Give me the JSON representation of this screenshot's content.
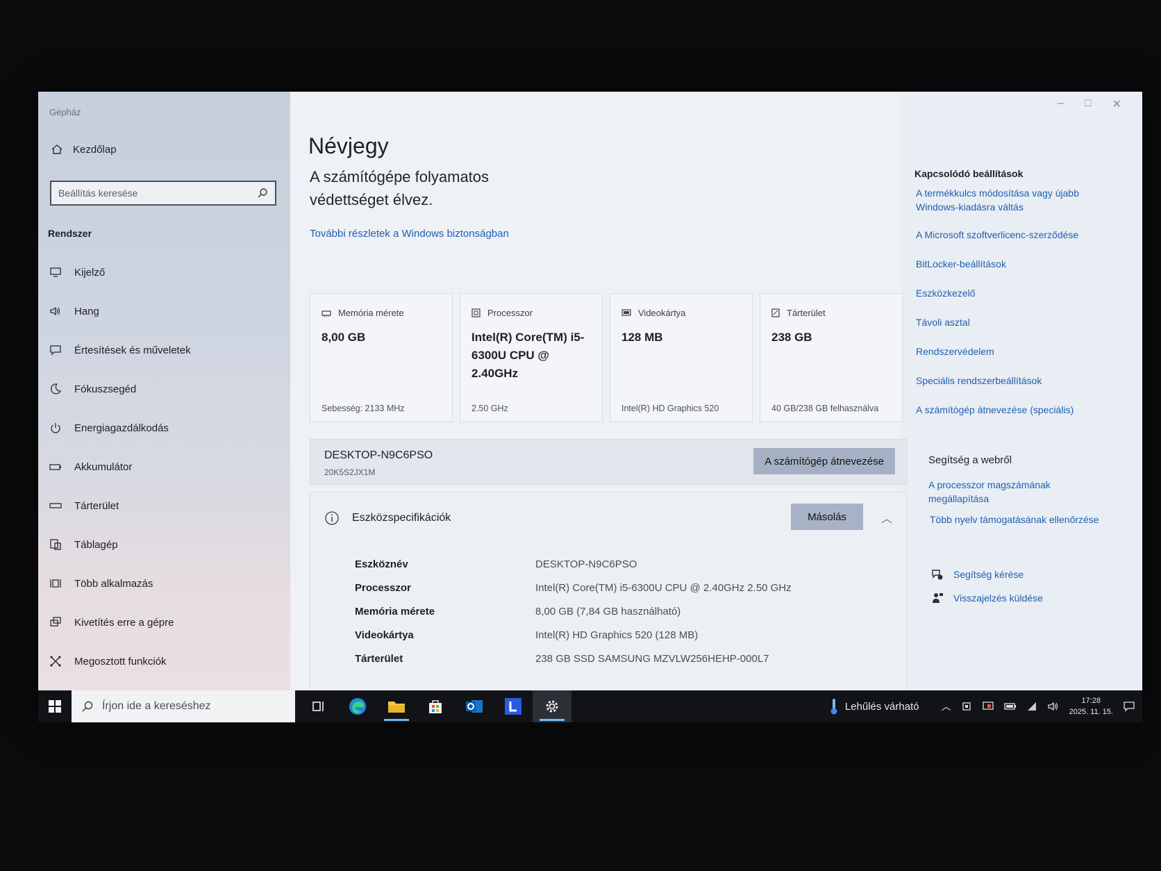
{
  "app_title": "Gépház",
  "window_controls": {
    "minimize": "–",
    "maximize": "□",
    "close": "✕"
  },
  "sidebar": {
    "home_label": "Kezdőlap",
    "search_placeholder": "Beállítás keresése",
    "section": "Rendszer",
    "items": [
      {
        "label": "Kijelző",
        "icon": "monitor-icon"
      },
      {
        "label": "Hang",
        "icon": "speaker-icon"
      },
      {
        "label": "Értesítések és műveletek",
        "icon": "notification-icon"
      },
      {
        "label": "Fókuszsegéd",
        "icon": "moon-icon"
      },
      {
        "label": "Energiagazdálkodás",
        "icon": "power-icon"
      },
      {
        "label": "Akkumulátor",
        "icon": "battery-icon"
      },
      {
        "label": "Tárterület",
        "icon": "storage-icon"
      },
      {
        "label": "Táblagép",
        "icon": "tablet-icon"
      },
      {
        "label": "Több alkalmazás",
        "icon": "multitask-icon"
      },
      {
        "label": "Kivetítés erre a gépre",
        "icon": "project-icon"
      },
      {
        "label": "Megosztott funkciók",
        "icon": "shared-icon"
      }
    ]
  },
  "main": {
    "title": "Névjegy",
    "protection_text": "A számítógépe folyamatos védettséget élvez.",
    "security_link": "További részletek a Windows biztonságban",
    "cards": [
      {
        "head": "Memória mérete",
        "value": "8,00 GB",
        "foot": "Sebesség: 2133 MHz",
        "icon": "memory-icon"
      },
      {
        "head": "Processzor",
        "value": "Intel(R) Core(TM) i5-6300U CPU @ 2.40GHz",
        "foot": "2.50 GHz",
        "icon": "cpu-icon"
      },
      {
        "head": "Videokártya",
        "value": "128 MB",
        "foot": "Intel(R) HD Graphics 520",
        "icon": "gpu-icon"
      },
      {
        "head": "Tárterület",
        "value": "238 GB",
        "foot": "40 GB/238 GB felhasználva",
        "icon": "disk-icon"
      }
    ],
    "pc_name": "DESKTOP-N9C6PSO",
    "pc_model": "20K5S2JX1M",
    "rename_button": "A számítógép átnevezése",
    "specs_title": "Eszközspecifikációk",
    "copy_button": "Másolás",
    "specs": [
      {
        "key": "Eszköznév",
        "value": "DESKTOP-N9C6PSO"
      },
      {
        "key": "Processzor",
        "value": "Intel(R) Core(TM) i5-6300U CPU @ 2.40GHz   2.50 GHz"
      },
      {
        "key": "Memória mérete",
        "value": "8,00 GB (7,84 GB használható)"
      },
      {
        "key": "Videokártya",
        "value": "Intel(R) HD Graphics 520 (128 MB)"
      },
      {
        "key": "Tárterület",
        "value": "238 GB SSD SAMSUNG MZVLW256HEHP-000L7"
      }
    ]
  },
  "related": {
    "title": "Kapcsolódó beállítások",
    "links": [
      "A termékkulcs módosítása vagy újabb Windows-kiadásra váltás",
      "A Microsoft szoftverlicenc-szerződése",
      "BitLocker-beállítások",
      "Eszközkezelő",
      "Távoli asztal",
      "Rendszervédelem",
      "Speciális rendszerbeállítások",
      "A számítógép átnevezése (speciális)"
    ],
    "web_title": "Segítség a webről",
    "web_links": [
      "A processzor magszámának megállapítása",
      "Több nyelv támogatásának ellenőrzése"
    ],
    "help_label": "Segítség kérése",
    "feedback_label": "Visszajelzés küldése"
  },
  "taskbar": {
    "search_placeholder": "Írjon ide a kereséshez",
    "weather": "Lehűlés várható",
    "time": "17:28",
    "date": "2025. 11. 15.",
    "accent": "#76b9ed"
  }
}
